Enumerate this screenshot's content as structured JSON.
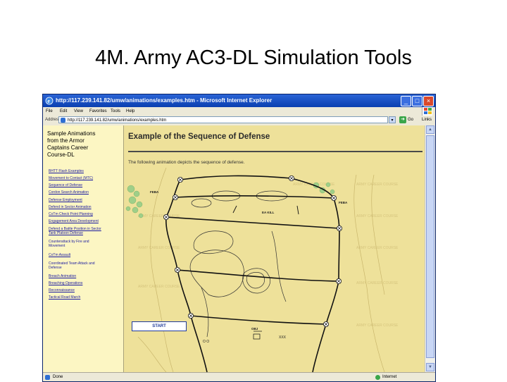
{
  "slide": {
    "title": "4M. Army AC3-DL Simulation Tools"
  },
  "window": {
    "title": "http://117.239.141.82/umw/animations/examples.htm - Microsoft Internet Explorer",
    "minimize": "_",
    "maximize": "□",
    "close": "×"
  },
  "menu": [
    "File",
    "Edit",
    "View",
    "Favorites",
    "Tools",
    "Help"
  ],
  "address": {
    "label": "Address",
    "url": "http://117.239.141.82/umw/animations/examples.htm",
    "go_label": "Go",
    "links_label": "Links"
  },
  "sidebar": {
    "heading_lines": [
      "Sample Animations",
      "from the Armor",
      "Captains Career",
      "Course-DL"
    ],
    "links": [
      "BHTT Flash Examples",
      "Movement to Contact (MTC)",
      "Sequence of Defense",
      "Cordon Search Animation",
      "Defense Employment",
      "Defend in Sector Animation",
      "CoTm Check Point Planning",
      "Engagement Area Development",
      "Defend a Battle Position in Sector",
      "Tank Platoon Defense",
      "Counterattack by Fire and",
      "Movement",
      "CoTm Assault",
      "Coordinated Team Attack and",
      "Defense",
      "Breach Animation",
      "Breaching Operations",
      "Reconnaissance",
      "Tactical Road March"
    ]
  },
  "content": {
    "heading": "Example of the Sequence of Defense",
    "intro": "The following animation depicts the sequence of defense.",
    "start_label": "START",
    "map_labels": {
      "feba_left": "FEBA",
      "feba_right": "FEBA",
      "ea_kill": "EA KILL",
      "obj": "OBJ",
      "left_small": "O O",
      "right_small": "XXX"
    },
    "watermark": "ARMY CAREER COURSE"
  },
  "status": {
    "text": "Done",
    "zone": "Internet"
  },
  "colors": {
    "window_frame": "#0a246a",
    "title_bar": "#0a3fb0",
    "nav_background": "#fcf6c3",
    "content_background": "#eee19a",
    "link_color": "#1a1aa0",
    "vegetation": "#9fcf89"
  },
  "icons": {
    "browser": "ie-icon",
    "go": "go-arrow-icon",
    "status_page": "page-icon",
    "zone": "internet-zone-icon",
    "waypoint": "circled-x-icon"
  }
}
